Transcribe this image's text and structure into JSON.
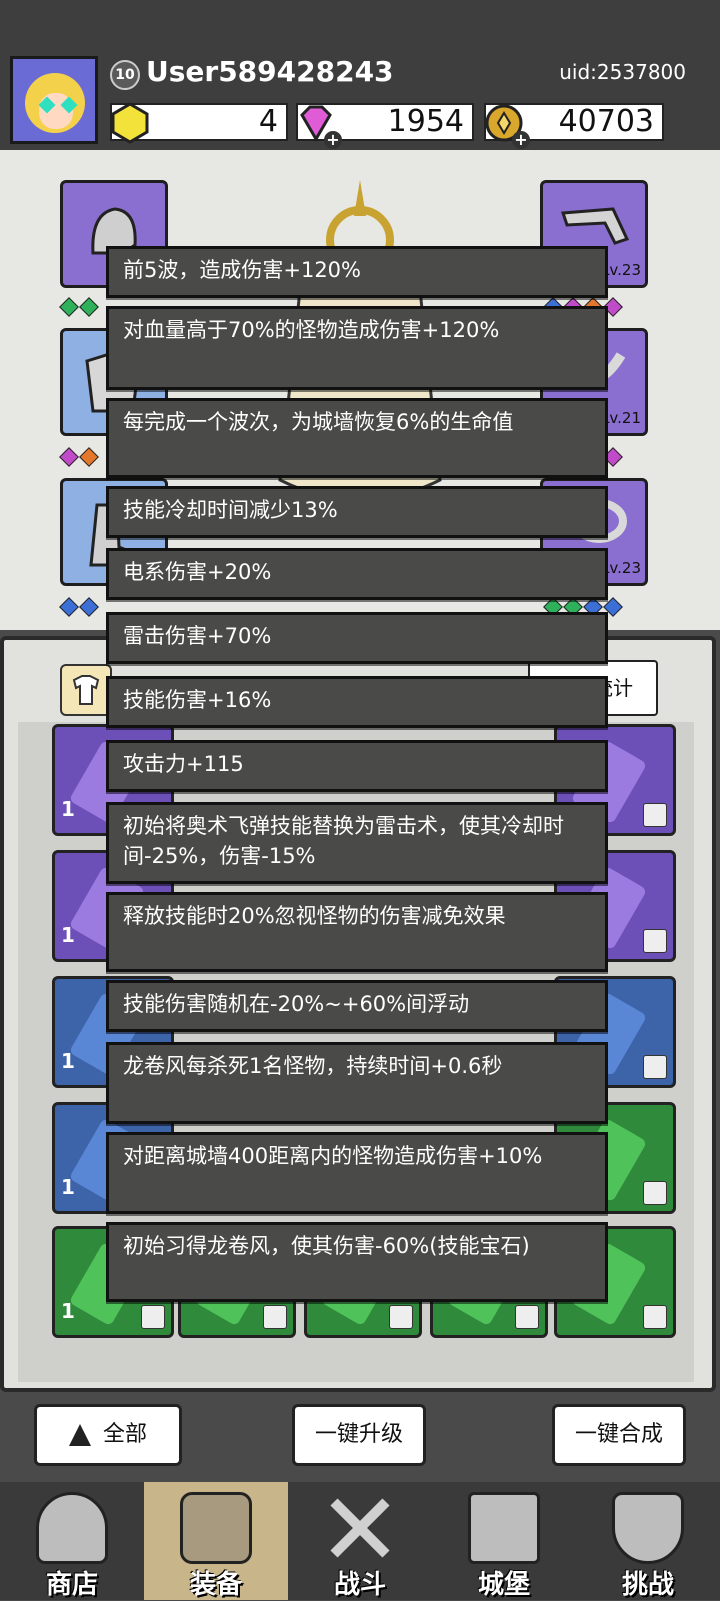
{
  "user": {
    "level": "10",
    "name": "User589428243",
    "uid": "uid:2537800"
  },
  "resources": {
    "gold_gem": "4",
    "diamond": "1954",
    "coins": "40703"
  },
  "equipment_levels": {
    "right_top": "Lv.23",
    "right_mid": "Lv.21",
    "right_bottom": "Lv.23"
  },
  "panel": {
    "stats_label": "属性统计"
  },
  "tooltips": [
    "前5波，造成伤害+120%",
    "对血量高于70%的怪物造成伤害+120%",
    "每完成一个波次，为城墙恢复6%的生命值",
    "技能冷却时间减少13%",
    "电系伤害+20%",
    "雷击伤害+70%",
    "技能伤害+16%",
    "攻击力+115",
    "初始将奥术飞弹技能替换为雷击术，使其冷却时间-25%，伤害-15%",
    "释放技能时20%忽视怪物的伤害减免效果",
    "技能伤害随机在-20%~+60%间浮动",
    "龙卷风每杀死1名怪物，持续时间+0.6秒",
    "对距离城墙400距离内的怪物造成伤害+10%",
    "初始习得龙卷风，使其伤害-60%(技能宝石)"
  ],
  "gem_counts": [
    "1",
    "1",
    "1",
    "1",
    "1"
  ],
  "buttons": {
    "all": "全部",
    "upgrade_all": "一键升级",
    "merge_all": "一键合成"
  },
  "nav": {
    "shop": "商店",
    "equipment": "装备",
    "battle": "战斗",
    "castle": "城堡",
    "challenge": "挑战"
  },
  "colors": {
    "tooltip_bg": "#4a4a48",
    "gem_purple": "#6d4fb8",
    "gem_blue": "#3d63a8",
    "gem_green": "#2f8a3c",
    "nav_active": "#c9b58a"
  }
}
